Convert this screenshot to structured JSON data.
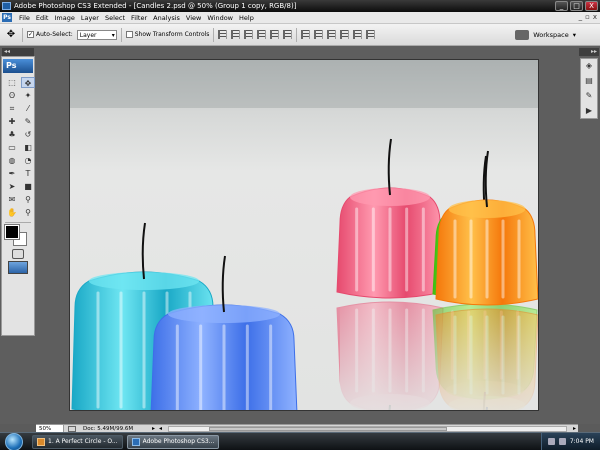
{
  "window": {
    "title": "Adobe Photoshop CS3 Extended - [Candles 2.psd @ 50% (Group 1 copy, RGB/8)]",
    "controls": {
      "minimize": "_",
      "maximize": "□",
      "close": "X"
    }
  },
  "menubar": {
    "logo": "Ps",
    "items": [
      "File",
      "Edit",
      "Image",
      "Layer",
      "Select",
      "Filter",
      "Analysis",
      "View",
      "Window",
      "Help"
    ],
    "doc_controls": {
      "minimize": "_",
      "restore": "▫",
      "close": "x"
    }
  },
  "options": {
    "auto_select_label": "Auto-Select:",
    "auto_select_checked": true,
    "auto_select_value": "Layer",
    "show_transform_label": "Show Transform Controls",
    "show_transform_checked": false,
    "workspace_label": "Workspace",
    "align_icon_count": 6,
    "distribute_icon_count": 6
  },
  "toolbox": {
    "logo": "Ps",
    "collapse": "◂◂",
    "tools": [
      {
        "name": "marquee-tool-icon",
        "glyph": "⬚"
      },
      {
        "name": "move-tool-icon",
        "glyph": "✥",
        "active": true
      },
      {
        "name": "lasso-tool-icon",
        "glyph": "ʘ"
      },
      {
        "name": "magic-wand-icon",
        "glyph": "✦"
      },
      {
        "name": "crop-tool-icon",
        "glyph": "⌗"
      },
      {
        "name": "slice-tool-icon",
        "glyph": "⁄"
      },
      {
        "name": "healing-brush-icon",
        "glyph": "✚"
      },
      {
        "name": "brush-tool-icon",
        "glyph": "✎"
      },
      {
        "name": "clone-stamp-icon",
        "glyph": "♣"
      },
      {
        "name": "history-brush-icon",
        "glyph": "↺"
      },
      {
        "name": "eraser-tool-icon",
        "glyph": "▭"
      },
      {
        "name": "gradient-tool-icon",
        "glyph": "◧"
      },
      {
        "name": "blur-tool-icon",
        "glyph": "◍"
      },
      {
        "name": "dodge-tool-icon",
        "glyph": "◔"
      },
      {
        "name": "pen-tool-icon",
        "glyph": "✒"
      },
      {
        "name": "type-tool-icon",
        "glyph": "T"
      },
      {
        "name": "path-selection-icon",
        "glyph": "➤"
      },
      {
        "name": "shape-tool-icon",
        "glyph": "■"
      },
      {
        "name": "notes-tool-icon",
        "glyph": "✉"
      },
      {
        "name": "eyedropper-tool-icon",
        "glyph": "⚲"
      },
      {
        "name": "hand-tool-icon",
        "glyph": "✋"
      },
      {
        "name": "zoom-tool-icon",
        "glyph": "⚲"
      }
    ]
  },
  "right_panel": {
    "collapse": "▸▸",
    "icons": [
      {
        "name": "navigator-panel-icon",
        "glyph": "◈"
      },
      {
        "name": "layers-panel-icon",
        "glyph": "▤"
      },
      {
        "name": "brushes-panel-icon",
        "glyph": "✎"
      },
      {
        "name": "actions-panel-icon",
        "glyph": "▶"
      }
    ]
  },
  "canvas": {
    "candles": [
      {
        "color": "green",
        "fill": "#3fbf0f",
        "light": "#8ff24a"
      },
      {
        "color": "cyan",
        "fill": "#19a8c6",
        "light": "#6fe6f2"
      },
      {
        "color": "blue",
        "fill": "#3d6fe8",
        "light": "#8fb2ff"
      },
      {
        "color": "pink",
        "fill": "#e64a6e",
        "light": "#ff9ab0"
      },
      {
        "color": "orange",
        "fill": "#f5780b",
        "light": "#ffc04a"
      }
    ]
  },
  "status": {
    "zoom": "50%",
    "doc_info": "Doc: 5.49M/99.6M",
    "arrow": "▸",
    "scroll_left": "◂",
    "scroll_right": "▸"
  },
  "taskbar": {
    "tasks": [
      {
        "label": "1. A Perfect Circle - O...",
        "active": false
      },
      {
        "label": "Adobe Photoshop CS3...",
        "active": true
      }
    ],
    "clock": "7:04 PM"
  },
  "colors": {
    "foreground": "#000000",
    "background": "#ffffff"
  }
}
